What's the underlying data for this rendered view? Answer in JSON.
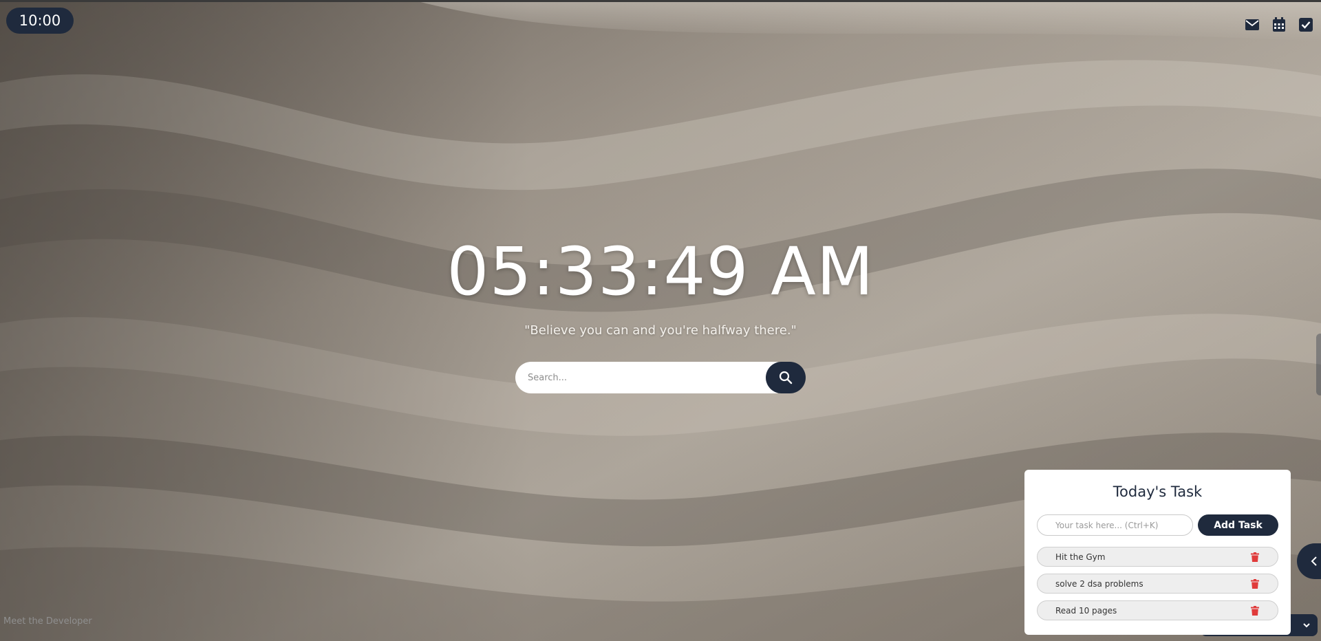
{
  "timer": {
    "label": "10:00"
  },
  "header_icons": [
    {
      "name": "mail-icon"
    },
    {
      "name": "calendar-icon"
    },
    {
      "name": "checkbox-icon"
    }
  ],
  "clock": {
    "time": "05:33:49 AM"
  },
  "quote": {
    "text": "\"Believe you can and you're halfway there.\""
  },
  "search": {
    "placeholder": "Search...",
    "value": "",
    "icon": "search-icon"
  },
  "footer": {
    "developer_link": "Meet the Developer"
  },
  "tasks": {
    "title": "Today's Task",
    "input_placeholder": "Your task here... (Ctrl+K)",
    "add_label": "Add Task",
    "items": [
      {
        "label": "Hit the Gym"
      },
      {
        "label": "solve 2 dsa problems"
      },
      {
        "label": "Read 10 pages"
      }
    ]
  },
  "colors": {
    "accent": "#1f2a3d",
    "delete": "#e03b3b",
    "panel": "#ffffff",
    "text_light": "#ffffff"
  }
}
